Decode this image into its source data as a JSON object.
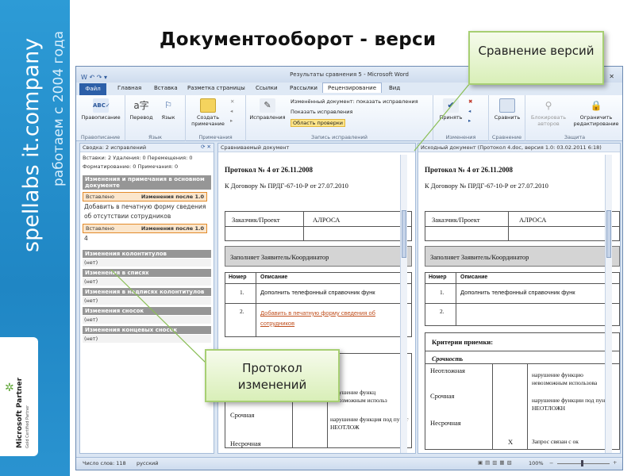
{
  "brand": {
    "site": "spellabs it.company",
    "since": "работаем с 2004 года",
    "partner_name": "Microsoft Partner",
    "partner_sub": "Gold Certified Partner"
  },
  "slide_title": "Документооборот - верси",
  "callouts": {
    "compare": "Сравнение версий",
    "protocol": "Протокол изменений"
  },
  "window": {
    "title": "Результаты сравнения 5 - Microsoft Word"
  },
  "tabs": [
    "Файл",
    "Главная",
    "Вставка",
    "Разметка страницы",
    "Ссылки",
    "Рассылки",
    "Рецензирование",
    "Вид"
  ],
  "ribbon": {
    "spelling": "Правописание",
    "translate": "Перевод",
    "language": "Язык",
    "create_note": "Создать примечание",
    "corrections": "Исправления",
    "show_changes_dd": "Изменённый документ: показать исправления",
    "show_changes": "Показать исправления",
    "review_area": "Область проверки",
    "accept": "Принять",
    "compare": "Сравнить",
    "block_authors": "Блокировать авторов",
    "restrict_edit": "Ограничить редактирование",
    "groups": [
      "Правописание",
      "Язык",
      "Примечания",
      "Запись исправлений",
      "Изменения",
      "Сравнение",
      "Защита"
    ]
  },
  "summary": {
    "header": "Сводка: 2 исправлений",
    "stats1": "Вставки: 2  Удаления: 0  Перемещения: 0",
    "stats2": "Форматирование: 0  Примечания: 0",
    "section_main": "Изменения и примечания в основном документе",
    "rev_type": "Вставлено",
    "rev_after": "Изменения после 1.0",
    "rev1_text": "Добавить в печатную форму сведения об отсутствии сотрудников",
    "rev2_text": "4",
    "none": "(нет)",
    "sections": [
      "Изменения колонтитулов",
      "Изменения в списях",
      "Изменения в надписях колонтитулов",
      "Изменения сносок",
      "Изменения концевых сносок"
    ]
  },
  "doc_left": {
    "header": "Сравниваемый документ",
    "protocol": "Протокол № 4 от 26.11.2008",
    "contract": "К Договору № ПРДГ-67-10-Р от 27.07.2010",
    "customer_label": "Заказчик/Проект",
    "customer_value": "АЛРОСА",
    "applicant": "Заполняет Заявитель/Координатор",
    "col_num": "Номер",
    "col_desc": "Описание",
    "row1_num": "1.",
    "row1_text": "Дополнить телефонный справочник функ",
    "row2_num": "2.",
    "row2_text": "Добавить в печатную форму сведения об сотрудников",
    "urgent": "Срочная",
    "not_urgent": "Несрочная",
    "violation": "нарушение функц невозможным использ",
    "violation2": "нарушение функция под пункт НЕОТЛОЖ"
  },
  "doc_right": {
    "header": "Исходный документ (Протокол 4.doc, версия 1.0: 03.02.2011 6:18)",
    "criteria": "Критерии приемки:",
    "urgency": "Срочность",
    "urgent_now": "Неотложная",
    "violation": "нарушение функцио невозможным использова",
    "violation2": "нарушение функции под пункт НЕОТЛОЖН",
    "mark": "Х",
    "request": "Запрос связан с ок"
  },
  "status": {
    "words": "Число слов: 118",
    "lang": "русский",
    "zoom": "100%"
  }
}
